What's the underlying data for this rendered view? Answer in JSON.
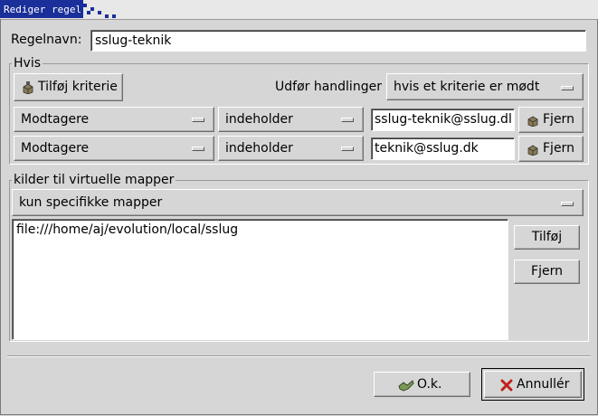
{
  "window": {
    "title": "Rediger regel"
  },
  "rule_name": {
    "label": "Regelnavn:",
    "value": "sslug-teknik"
  },
  "if_group": {
    "title": "Hvis",
    "add_button": "Tilføj kriterie",
    "perform_label": "Udfør handlinger",
    "perform_value": "hvis et kriterie er mødt",
    "criteria": [
      {
        "field": "Modtagere",
        "op": "indeholder",
        "value": "sslug-teknik@sslug.dl",
        "remove": "Fjern"
      },
      {
        "field": "Modtagere",
        "op": "indeholder",
        "value": "teknik@sslug.dk",
        "remove": "Fjern"
      }
    ]
  },
  "sources_group": {
    "title": "kilder til virtuelle mapper",
    "mode": "kun specifikke mapper",
    "items": [
      "file:///home/aj/evolution/local/sslug"
    ],
    "add_button": "Tilføj",
    "remove_button": "Fjern"
  },
  "footer": {
    "ok_button": "O.k.",
    "cancel_button": "Annullér"
  },
  "colors": {
    "title_bar": "#1a2f9a",
    "window_bg": "#d6d6d6"
  }
}
